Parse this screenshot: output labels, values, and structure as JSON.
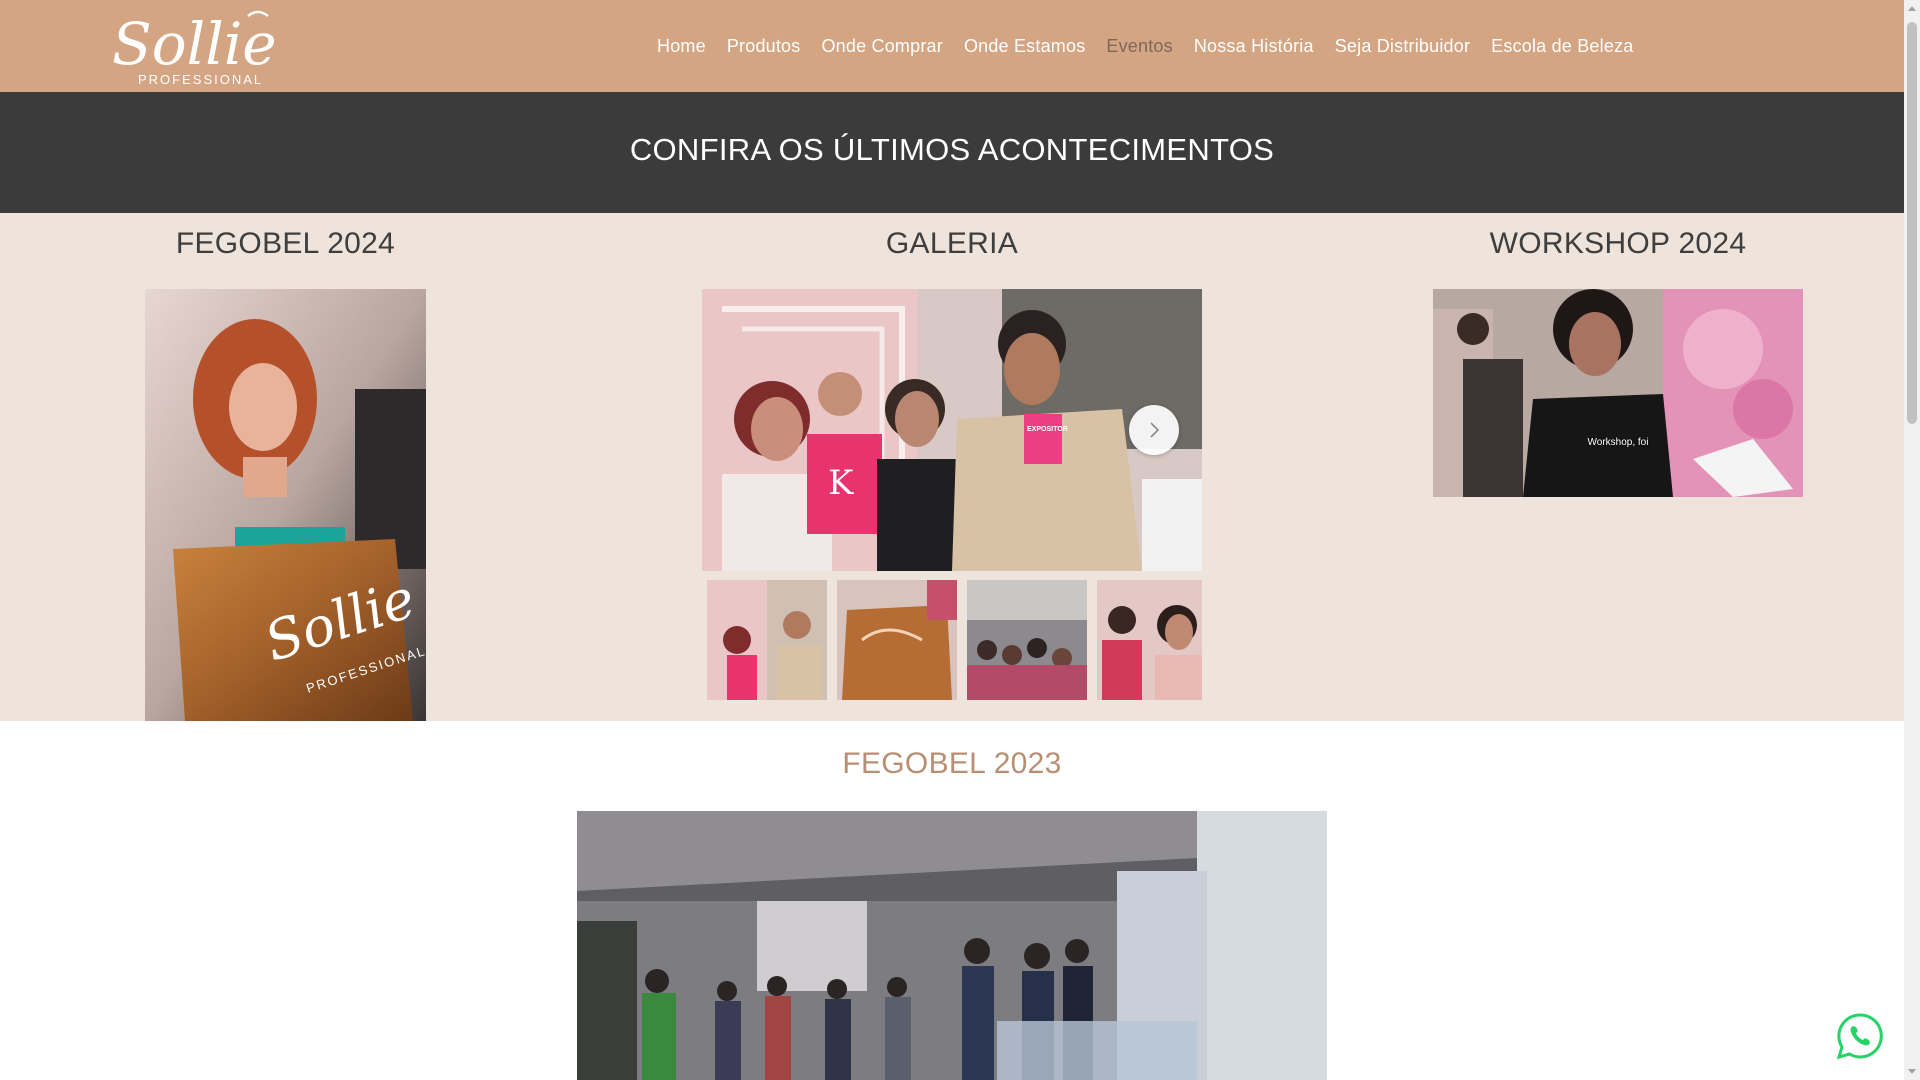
{
  "header": {
    "logo": {
      "wordmark": "Sollie",
      "tagline": "PROFESSIONAL"
    },
    "nav": [
      {
        "label": "Home",
        "active": false
      },
      {
        "label": "Produtos",
        "active": false
      },
      {
        "label": "Onde Comprar",
        "active": false
      },
      {
        "label": "Onde Estamos",
        "active": false
      },
      {
        "label": "Eventos",
        "active": true
      },
      {
        "label": "Nossa História",
        "active": false
      },
      {
        "label": "Seja Distribuidor",
        "active": false
      },
      {
        "label": "Escola de Beleza",
        "active": false
      }
    ]
  },
  "banner": {
    "title": "CONFIRA OS ÚLTIMOS ACONTECIMENTOS"
  },
  "events": {
    "fegobel_2024": {
      "title": "FEGOBEL 2024",
      "bag_text": "Sollie",
      "bag_subtext": "PROFESSIONAL"
    },
    "gallery": {
      "title": "GALERIA",
      "badge_text": "EXPOSITOR",
      "shirt_letter": "K",
      "thumb_count": 4
    },
    "workshop_2024": {
      "title": "WORKSHOP 2024",
      "video_caption": "Workshop, foi"
    }
  },
  "fegobel_2023": {
    "title": "FEGOBEL 2023"
  },
  "colors": {
    "header_bg": "#d3a583",
    "banner_bg": "#3b3b3b",
    "events_bg": "#efe4dc",
    "accent_title": "#b88f73",
    "nav_active": "#7e6859",
    "whatsapp": "#25d366"
  },
  "icons": {
    "gallery_next": "chevron-right-icon",
    "whatsapp": "whatsapp-icon"
  }
}
